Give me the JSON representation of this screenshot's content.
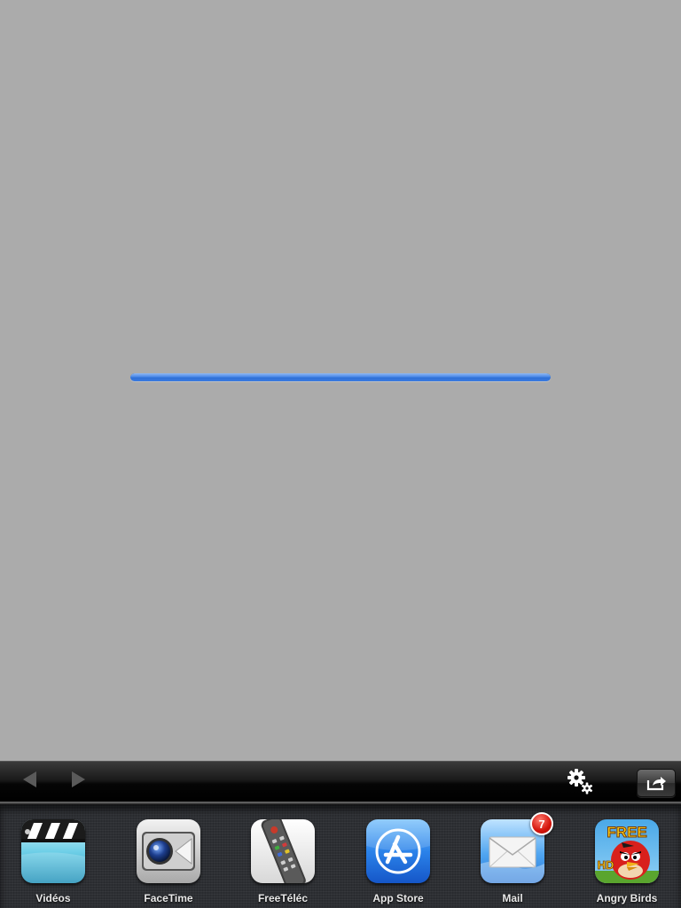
{
  "content": {
    "progress": 1.0,
    "progress_color": "#3a7be0"
  },
  "toolbar": {
    "back_icon": "triangle-left",
    "forward_icon": "triangle-right",
    "settings_icon": "gears",
    "share_icon": "share-arrow"
  },
  "dock": {
    "apps": [
      {
        "label": "Vidéos",
        "icon": "clapperboard"
      },
      {
        "label": "FaceTime",
        "icon": "camera"
      },
      {
        "label": "FreeTéléc",
        "icon": "remote-control"
      },
      {
        "label": "App Store",
        "icon": "app-store-a"
      },
      {
        "label": "Mail",
        "icon": "envelope",
        "badge": "7"
      },
      {
        "label": "Angry Birds",
        "icon": "red-bird",
        "icon_text_1": "FREE",
        "icon_text_2": "HD"
      }
    ]
  }
}
